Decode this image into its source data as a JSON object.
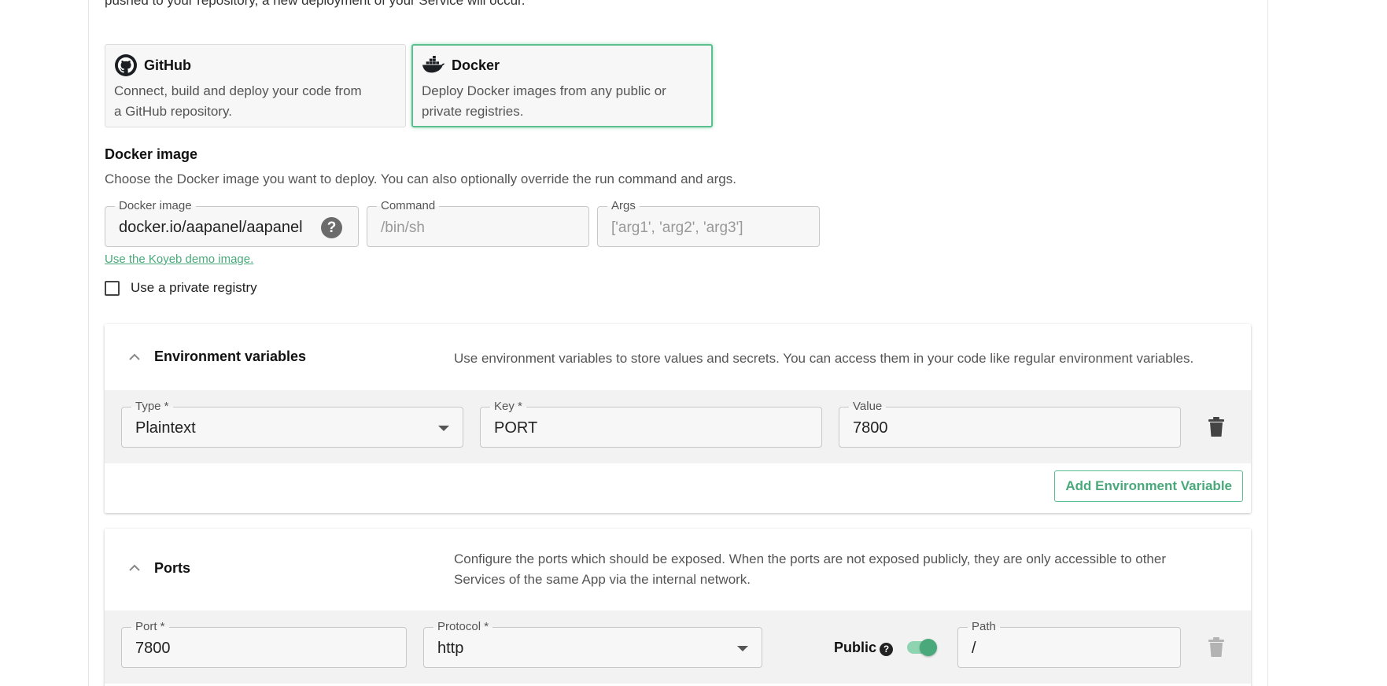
{
  "intro": {
    "text": "pushed to your repository, a new deployment of your Service will occur."
  },
  "source_options": [
    {
      "title": "GitHub",
      "icon": "github-icon",
      "description_line1": "Connect, build and deploy your code from",
      "description_line2": "a GitHub repository.",
      "selected": false
    },
    {
      "title": "Docker",
      "icon": "docker-icon",
      "description_line1": "Deploy Docker images from any public or",
      "description_line2": "private registries.",
      "selected": true
    }
  ],
  "docker_image_section": {
    "title": "Docker image",
    "description": "Choose the Docker image you want to deploy. You can also optionally override the run command and args.",
    "image_field": {
      "label": "Docker image",
      "value": "docker.io/aapanel/aapanel",
      "help": "?"
    },
    "command_field": {
      "label": "Command",
      "placeholder": "/bin/sh"
    },
    "args_field": {
      "label": "Args",
      "placeholder": "['arg1', 'arg2', 'arg3']"
    },
    "demo_link": "Use the Koyeb demo image.",
    "private_registry_label": "Use a private registry"
  },
  "env_section": {
    "title": "Environment variables",
    "description": "Use environment variables to store values and secrets. You can access them in your code like regular environment variables.",
    "type_label": "Type *",
    "type_value": "Plaintext",
    "key_label": "Key *",
    "key_value": "PORT",
    "value_label": "Value",
    "value_value": "7800",
    "add_button": "Add Environment Variable"
  },
  "ports_section": {
    "title": "Ports",
    "description_line1": "Configure the ports which should be exposed. When the ports are not exposed publicly, they are only accessible to other",
    "description_line2": "Services of the same App via the internal network.",
    "port_label": "Port *",
    "port_value": "7800",
    "protocol_label": "Protocol *",
    "protocol_value": "http",
    "public_label": "Public",
    "public_enabled": true,
    "path_label": "Path",
    "path_value": "/"
  },
  "colors": {
    "accent": "#4aa97b",
    "accent_border": "#5cbf8f"
  }
}
